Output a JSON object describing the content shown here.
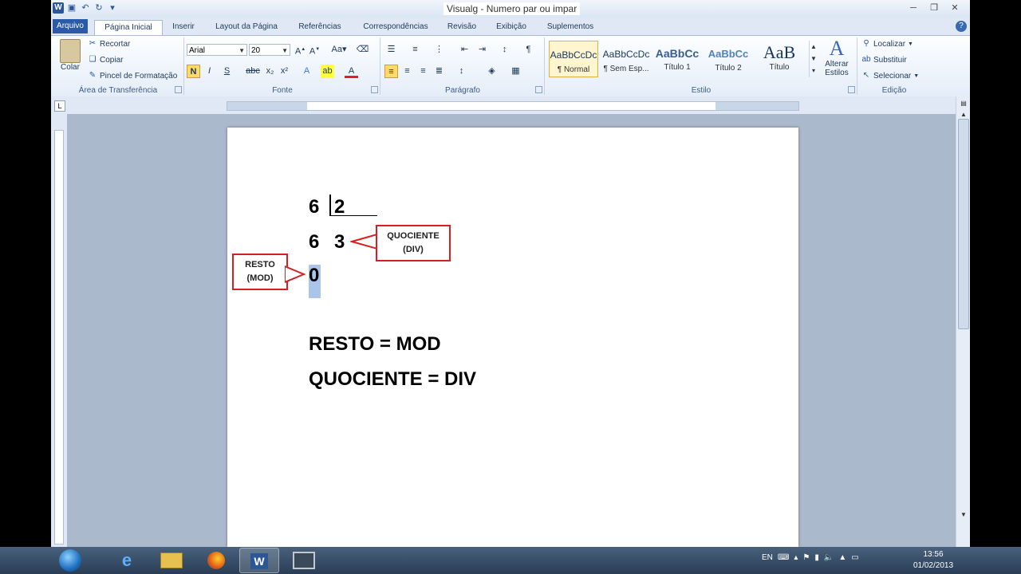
{
  "window": {
    "title": "Visualg - Numero par ou impar"
  },
  "tabs": [
    "Arquivo",
    "Página Inicial",
    "Inserir",
    "Layout da Página",
    "Referências",
    "Correspondências",
    "Revisão",
    "Exibição",
    "Suplementos"
  ],
  "ribbon": {
    "clipboard": {
      "label": "Área de Transferência",
      "paste": "Colar",
      "cut": "Recortar",
      "copy": "Copiar",
      "format_painter": "Pincel de Formatação"
    },
    "font": {
      "label": "Fonte",
      "family": "Arial",
      "size": "20"
    },
    "paragraph": {
      "label": "Parágrafo"
    },
    "styles": {
      "label": "Estilo",
      "items": [
        {
          "preview": "AaBbCcDc",
          "name": "¶ Normal"
        },
        {
          "preview": "AaBbCcDc",
          "name": "¶ Sem Esp..."
        },
        {
          "preview": "AaBbCc",
          "name": "Título 1"
        },
        {
          "preview": "AaBbCc",
          "name": "Título 2"
        },
        {
          "preview": "AaB",
          "name": "Título"
        }
      ],
      "change_styles": "Alterar Estilos"
    },
    "editing": {
      "label": "Edição",
      "find": "Localizar",
      "replace": "Substituir",
      "select": "Selecionar"
    }
  },
  "document": {
    "dividend": "6",
    "divisor": "2",
    "product": "6",
    "quotient": "3",
    "remainder": "0",
    "callout_quotient": [
      "QUOCIENTE",
      "(DIV)"
    ],
    "callout_remainder": [
      "RESTO",
      "(MOD)"
    ],
    "line1": "RESTO = MOD",
    "line2": "QUOCIENTE = DIV"
  },
  "taskbar": {
    "language": "EN",
    "time": "13:56",
    "date": "01/02/2013"
  }
}
